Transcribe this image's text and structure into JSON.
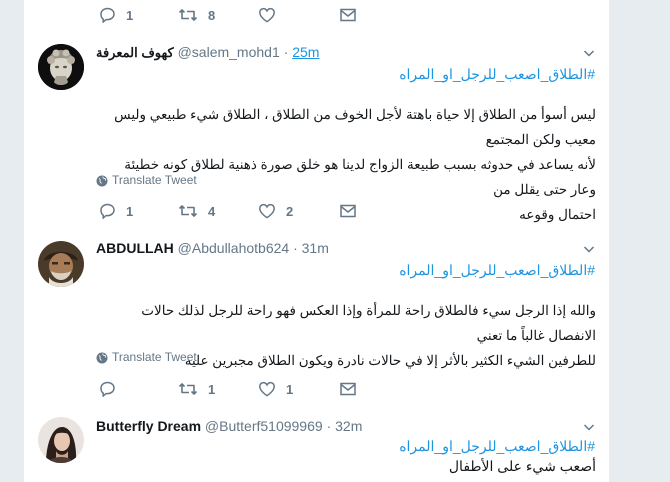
{
  "tweets": [
    {
      "partial": true,
      "actions": {
        "reply": "1",
        "retweet": "8",
        "like": ""
      }
    },
    {
      "name": "كهوف المعرفة",
      "handle": "@salem_mohd1",
      "dot": "·",
      "time": "25m",
      "hashtag": "#الطلاق_اصعب_للرجل_او_المراه",
      "body": [
        "ليس أسوأ من الطلاق إلا حياة باهتة لأجل الخوف من الطلاق ، الطلاق شيء طبيعي وليس معيب ولكن المجتمع",
        "لأنه يساعد في حدوثه بسبب طبيعة الزواج لدينا هو خلق صورة ذهنية لطلاق كونه خطيئة وعار حتى يقلل من",
        "احتمال وقوعه"
      ],
      "translate": "Translate Tweet",
      "actions": {
        "reply": "1",
        "retweet": "4",
        "like": "2"
      }
    },
    {
      "name": "ABDULLAH",
      "handle": "@Abdullahotb624",
      "dot": "·",
      "time": "31m",
      "hashtag": "#الطلاق_اصعب_للرجل_او_المراه",
      "body": [
        "والله إذا الرجل سيء فالطلاق راحة للمرأة وإذا العكس فهو راحة للرجل لذلك حالات الانفصال غالباً ما تعني",
        "للطرفين الشيء الكثير بالأثر إلا في حالات نادرة ويكون الطلاق مجبرين عليه"
      ],
      "translate": "Translate Tweet",
      "actions": {
        "reply": "",
        "retweet": "1",
        "like": "1"
      }
    },
    {
      "name": "Butterfly Dream",
      "handle": "@Butterf51099969",
      "dot": "·",
      "time": "32m",
      "hashtag": "#الطلاق_اصعب_للرجل_او_المراه",
      "body": [
        "أصعب شيء على الأطفال"
      ]
    }
  ],
  "colors": {
    "link": "#1b95e0",
    "muted": "#657786",
    "text": "#14171a",
    "divider": "#e6ecf0",
    "background": "#e6ecf0"
  },
  "icons": [
    "reply-icon",
    "retweet-icon",
    "like-icon",
    "message-icon",
    "globe-icon",
    "chevron-down-icon"
  ]
}
